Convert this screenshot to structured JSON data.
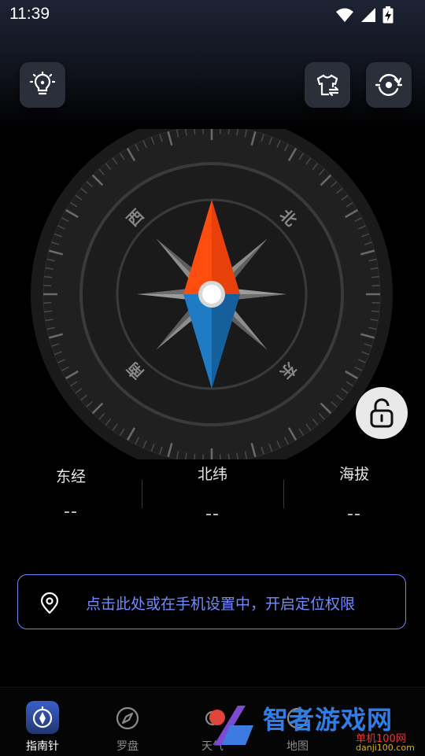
{
  "status_bar": {
    "time": "11:39"
  },
  "toolbar": {
    "light_icon": "bulb-icon",
    "skin_icon": "shirt-swap-icon",
    "calibrate_icon": "rotate-target-icon"
  },
  "compass": {
    "directions": {
      "north": "北",
      "east": "东",
      "south": "南",
      "west": "西"
    },
    "colors": {
      "needle_north": "#ff4d0f",
      "needle_south": "#1e7bc4"
    }
  },
  "info": [
    {
      "label": "东经",
      "value": "--"
    },
    {
      "label": "北纬",
      "value": "--"
    },
    {
      "label": "海拔",
      "value": "--"
    }
  ],
  "location_banner": {
    "text": "点击此处或在手机设置中，开启定位权限"
  },
  "nav": {
    "items": [
      {
        "label": "指南针",
        "active": true
      },
      {
        "label": "罗盘",
        "active": false
      },
      {
        "label": "天气",
        "active": false
      },
      {
        "label": "地图",
        "active": false
      }
    ]
  },
  "watermark": {
    "title": "智者游戏网",
    "sub": "danji100.com",
    "sub_cn": "单机100网"
  }
}
